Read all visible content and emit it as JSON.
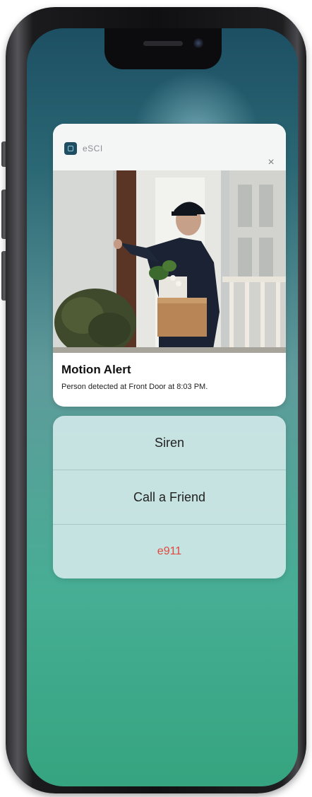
{
  "notification": {
    "app_name": "eSCI",
    "close_glyph": "×",
    "title": "Motion Alert",
    "body": "Person detected at Front Door at 8:03 PM.",
    "photo_subject": "delivery-person-at-front-door"
  },
  "actions": [
    {
      "label": "Siren"
    },
    {
      "label": "Call a Friend"
    },
    {
      "label": "e911",
      "color": "#e0473e"
    }
  ],
  "colors": {
    "wallpaper_top": "#1d4f63",
    "wallpaper_bottom": "#36a47f",
    "accent_danger": "#e0473e"
  }
}
